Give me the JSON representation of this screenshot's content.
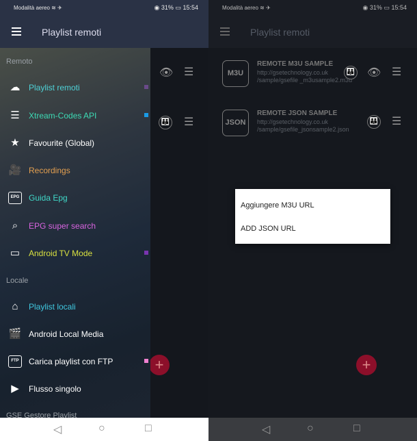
{
  "status": {
    "mode": "Modalità aereo",
    "battery": "31%",
    "time": "15:54"
  },
  "toolbar": {
    "title": "Playlist remoti"
  },
  "drawer": {
    "sections": [
      "Remoto",
      "Locale",
      "GSE Gestore Playlist"
    ],
    "remote_items": [
      {
        "label": "Playlist remoti",
        "icon": "cloud-icon",
        "color": "#4fd3d8",
        "dot": "#6a4a8a"
      },
      {
        "label": "Xtream-Codes API",
        "icon": "server-icon",
        "color": "#3ddbb5",
        "dot": "#1a9be6"
      },
      {
        "label": "Favourite (Global)",
        "icon": "star-icon",
        "color": "#ffffff"
      },
      {
        "label": "Recordings",
        "icon": "camera-icon",
        "color": "#e4a050"
      },
      {
        "label": "Guida Epg",
        "icon": "epg-icon",
        "color": "#40d8c8",
        "icon_text": "EPG"
      },
      {
        "label": "EPG super search",
        "icon": "search-icon",
        "color": "#d964e0"
      },
      {
        "label": "Android TV Mode",
        "icon": "tv-icon",
        "color": "#d8e040",
        "dot": "#7a35b0"
      }
    ],
    "local_items": [
      {
        "label": "Playlist locali",
        "icon": "home-icon",
        "color": "#40c8e0"
      },
      {
        "label": "Android Local Media",
        "icon": "clapper-icon",
        "color": "#ffffff"
      },
      {
        "label": "Carica playlist con FTP",
        "icon": "ftp-icon",
        "color": "#ffffff",
        "icon_text": "FTP",
        "dot": "#f080d0"
      },
      {
        "label": "Flusso singolo",
        "icon": "play-icon",
        "color": "#ffffff"
      }
    ]
  },
  "playlists": [
    {
      "logo": "M3U",
      "title": "REMOTE M3U SAMPLE",
      "url": "http://gsetechnology.co.uk /sample/gsefile _m3usample2.m3u"
    },
    {
      "logo": "JSON",
      "title": "REMOTE JSON SAMPLE",
      "url": "http://gsetechnology.co.uk /sample/gsefile_jsonsample2.json"
    }
  ],
  "dialog": {
    "options": [
      "Aggiungere M3U URL",
      "ADD JSON URL"
    ]
  },
  "fab": {
    "label": "+"
  },
  "nav": {
    "back": "◁",
    "home": "○",
    "recent": "□"
  }
}
